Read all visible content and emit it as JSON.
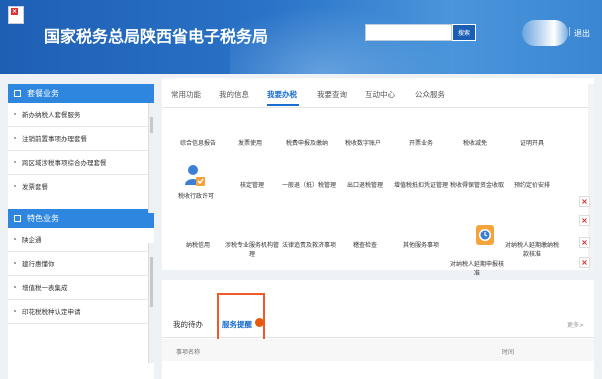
{
  "header": {
    "site_title": "国家税务总局陕西省电子税务局",
    "search_button": "搜索",
    "separator": "|",
    "logout": "退出"
  },
  "sidebar": {
    "section1_title": "套餐业务",
    "section1_items": [
      "新办纳税人套餐服务",
      "注销前置事项办理套餐",
      "跨区域涉税事项综合办理套餐",
      "发票套餐"
    ],
    "section2_title": "特色业务",
    "section2_items": [
      "陕企通",
      "建行惠懂你",
      "增值税一表集成",
      "印花税税种认定申请"
    ]
  },
  "main": {
    "tabs": [
      "常用功能",
      "我的信息",
      "我要办税",
      "我要查询",
      "互动中心",
      "公众服务"
    ],
    "active_tab": "我要办税",
    "row1": [
      "综合信息报告",
      "发票使用",
      "税费申报及缴纳",
      "税收数字账户",
      "开票业务",
      "税收减免",
      "证明开具"
    ],
    "row2": [
      "税收行政许可",
      "核定管理",
      "一般退（抵）税管理",
      "出口退税管理",
      "增值税抵扣凭证管理",
      "税收得保管资金收取",
      "预约定价安排"
    ],
    "row3": [
      "纳税信用",
      "涉税专业服务机构管理",
      "法律追责及救济事项",
      "稽查检查",
      "其他服务事项",
      "对纳税人延期申报核准",
      "对纳税人延期缴纳税款核准"
    ]
  },
  "bottom": {
    "tab_todo": "我的待办",
    "tab_reminder": "服务提醒",
    "more": "更多>",
    "col_name": "事项名称",
    "col_time": "时间"
  },
  "colors": {
    "header_blue": "#2a73c8",
    "accent_blue": "#1b6ecf",
    "highlight_orange": "#f05a28",
    "close_red": "#d22222"
  }
}
